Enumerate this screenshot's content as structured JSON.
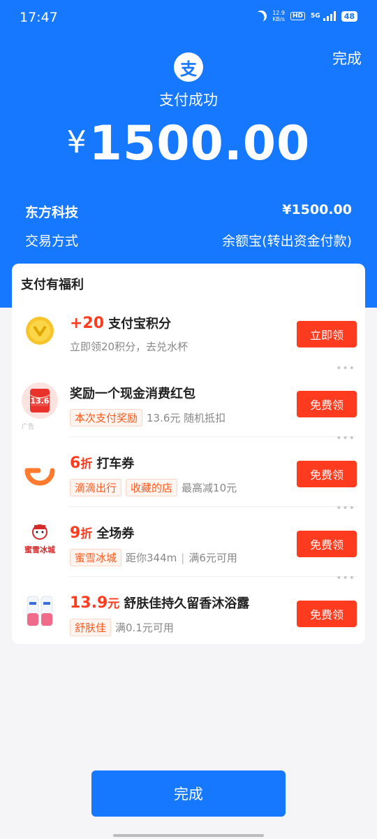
{
  "status_bar": {
    "time": "17:47",
    "net_speed_value": "12.9",
    "net_speed_unit": "KB/s",
    "hd": "HD",
    "network": "5G",
    "battery": "48"
  },
  "header": {
    "done_label": "完成",
    "logo_glyph": "支",
    "title": "支付成功",
    "currency": "¥",
    "amount": "1500.00"
  },
  "details": {
    "merchant": "东方科技",
    "merchant_amount": "¥1500.00",
    "method_label": "交易方式",
    "method_value": "余额宝(转出资金付款)"
  },
  "benefits": {
    "title": "支付有福利",
    "items": [
      {
        "highlight": "+20",
        "title": "支付宝积分",
        "subtitle": "立即领20积分，去兑水杯",
        "button": "立即领"
      },
      {
        "title": "奖励一个现金消费红包",
        "tag": "本次支付奖励",
        "desc": "13.6元 随机抵扣",
        "thumb_text": "13.6",
        "ad_label": "广告",
        "button": "免费领"
      },
      {
        "highlight_num": "6",
        "highlight_unit": "折",
        "title": "打车券",
        "tag1": "滴滴出行",
        "tag2": "收藏的店",
        "desc": "最高减10元",
        "button": "免费领"
      },
      {
        "highlight_num": "9",
        "highlight_unit": "折",
        "title": "全场券",
        "tag": "蜜雪冰城",
        "desc1": "距你344m",
        "sep": "|",
        "desc2": "满6元可用",
        "thumb_text": "蜜雪冰城",
        "button": "免费领"
      },
      {
        "highlight_num": "13.9",
        "highlight_unit": "元",
        "title": "舒肤佳持久留香沐浴露",
        "tag": "舒肤佳",
        "desc": "满0.1元可用",
        "button": "免费领"
      }
    ]
  },
  "footer": {
    "done_label": "完成"
  },
  "colors": {
    "brand_blue": "#1677ff",
    "accent_red": "#ff3b1f",
    "tag_orange": "#ff5a1f"
  }
}
